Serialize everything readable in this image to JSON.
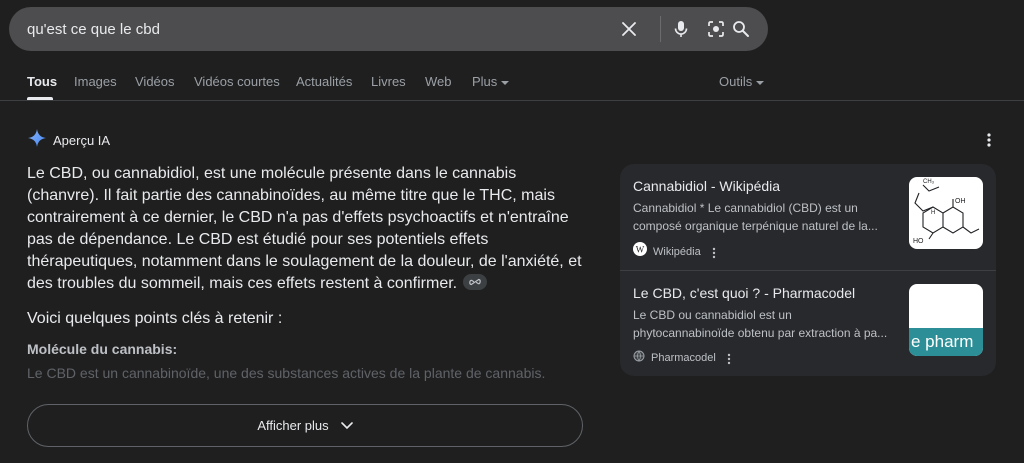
{
  "search": {
    "query": "qu'est ce que le cbd"
  },
  "tabs": [
    {
      "label": "Tous"
    },
    {
      "label": "Images"
    },
    {
      "label": "Vidéos"
    },
    {
      "label": "Vidéos courtes"
    },
    {
      "label": "Actualités"
    },
    {
      "label": "Livres"
    },
    {
      "label": "Web"
    },
    {
      "label": "Plus"
    }
  ],
  "tools_label": "Outils",
  "ai_overview": {
    "label": "Aperçu IA",
    "paragraph": "Le CBD, ou cannabidiol, est une molécule présente dans le cannabis (chanvre). Il fait partie des cannabinoïdes, au même titre que le THC, mais contrairement à ce dernier, le CBD n'a pas d'effets psychoactifs et n'entraîne pas de dépendance. Le CBD est étudié pour ses potentiels effets thérapeutiques, notamment dans le soulagement de la douleur, de l'anxiété, et des troubles du sommeil, mais ces effets restent à confirmer.",
    "points_intro": "Voici quelques points clés à retenir :",
    "point_title": "Molécule du cannabis:",
    "point_text": "Le CBD est un cannabinoïde, une des substances actives de la plante de cannabis.",
    "show_more": "Afficher plus"
  },
  "sources": [
    {
      "title": "Cannabidiol - Wikipédia",
      "snippet": "Cannabidiol * Le cannabidiol (CBD) est un composé organique terpénique naturel de la...",
      "site": "Wikipédia",
      "thumb_text": ""
    },
    {
      "title": "Le CBD, c'est quoi ? - Pharmacodel",
      "snippet": "Le CBD ou cannabidiol est un phytocannabinoïde obtenu par extraction à pa...",
      "site": "Pharmacodel",
      "thumb_text": "e pharm"
    }
  ],
  "colors": {
    "background": "#1f1f1f",
    "searchbar": "#4d4d4f",
    "source_card": "#28292c",
    "pharma_teal": "#2c8f97"
  }
}
